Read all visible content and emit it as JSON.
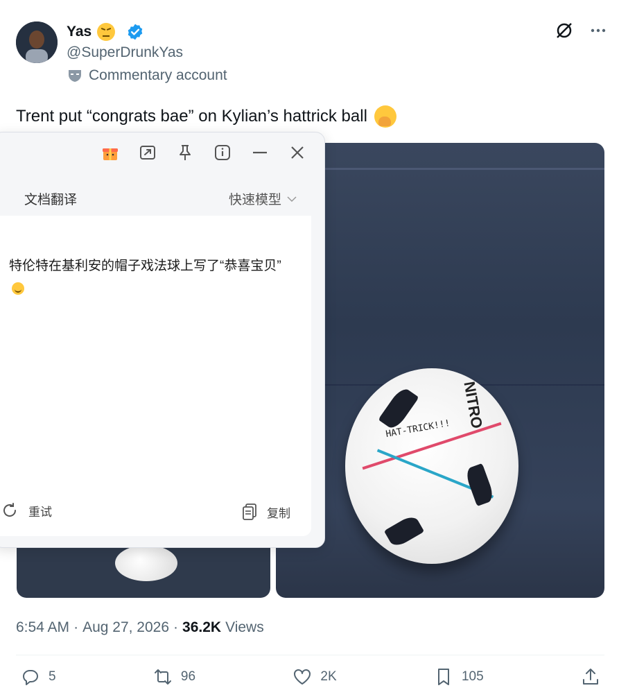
{
  "author": {
    "name": "Yas",
    "handle": "@SuperDrunkYas",
    "label": "Commentary account"
  },
  "tweet": {
    "text": "Trent put “congrats bae” on Kylian’s hattrick ball"
  },
  "media": {
    "ball_brand": "NITRO",
    "ball_sig": "HAT-TRICK!!!"
  },
  "translator": {
    "title": "文档翻译",
    "mode": "快速模型",
    "translation": "特伦特在基利安的帽子戏法球上写了“恭喜宝贝”",
    "retry": "重试",
    "copy": "复制"
  },
  "meta": {
    "time": "6:54 AM",
    "date": "Aug 27, 2026",
    "views_count": "36.2K",
    "views_label": "Views",
    "sep": "·"
  },
  "actions": {
    "replies": "5",
    "reposts": "96",
    "likes": "2K",
    "bookmarks": "105"
  },
  "colors": {
    "verified": "#1d9bf0",
    "text_secondary": "#536471"
  }
}
